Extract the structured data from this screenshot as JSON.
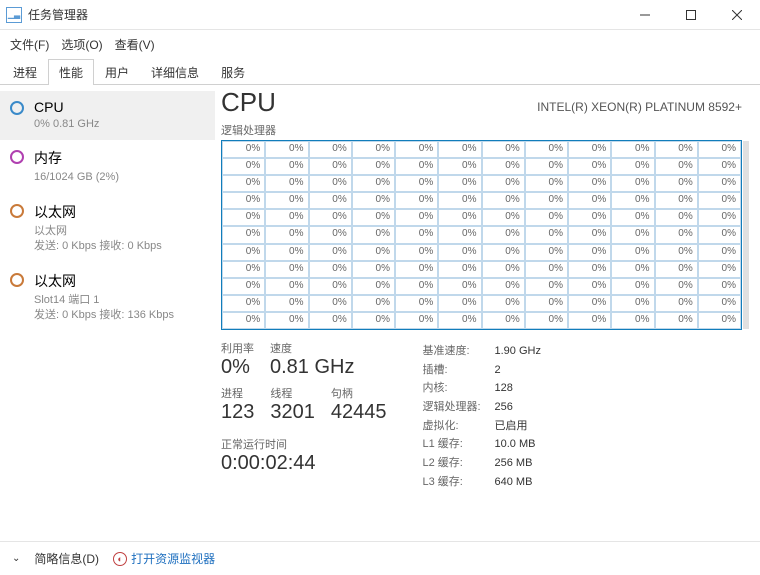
{
  "window": {
    "title": "任务管理器"
  },
  "menu": {
    "file": "文件(F)",
    "options": "选项(O)",
    "view": "查看(V)"
  },
  "tabs": [
    "进程",
    "性能",
    "用户",
    "详细信息",
    "服务"
  ],
  "sidebar": [
    {
      "title": "CPU",
      "sub": "0% 0.81 GHz",
      "dot": "cpu"
    },
    {
      "title": "内存",
      "sub": "16/1024 GB (2%)",
      "dot": "mem"
    },
    {
      "title": "以太网",
      "sub": "以太网\n发送: 0 Kbps 接收: 0 Kbps",
      "dot": "net"
    },
    {
      "title": "以太网",
      "sub": "Slot14 端口 1\n发送: 0 Kbps 接收: 136 Kbps",
      "dot": "net"
    }
  ],
  "main": {
    "heading": "CPU",
    "model": "INTEL(R) XEON(R) PLATINUM 8592+",
    "chart_label": "逻辑处理器",
    "cell_value": "0%",
    "util_label": "利用率",
    "util": "0%",
    "speed_label": "速度",
    "speed": "0.81 GHz",
    "proc_label": "进程",
    "proc": "123",
    "thr_label": "线程",
    "thr": "3201",
    "hnd_label": "句柄",
    "hnd": "42445",
    "uptime_label": "正常运行时间",
    "uptime": "0:00:02:44",
    "specs": [
      {
        "k": "基准速度:",
        "v": "1.90 GHz"
      },
      {
        "k": "插槽:",
        "v": "2"
      },
      {
        "k": "内核:",
        "v": "128"
      },
      {
        "k": "逻辑处理器:",
        "v": "256"
      },
      {
        "k": "虚拟化:",
        "v": "已启用"
      },
      {
        "k": "L1 缓存:",
        "v": "10.0 MB"
      },
      {
        "k": "L2 缓存:",
        "v": "256 MB"
      },
      {
        "k": "L3 缓存:",
        "v": "640 MB"
      }
    ]
  },
  "footer": {
    "brief": "简略信息(D)",
    "resmon": "打开资源监视器"
  },
  "chart_data": {
    "type": "heatmap",
    "title": "逻辑处理器",
    "rows": 11,
    "cols": 12,
    "xlabel": "",
    "ylabel": "",
    "values_note": "All 132 visible logical-processor cells display 0% utilization",
    "uniform_value": 0,
    "unit": "%"
  }
}
